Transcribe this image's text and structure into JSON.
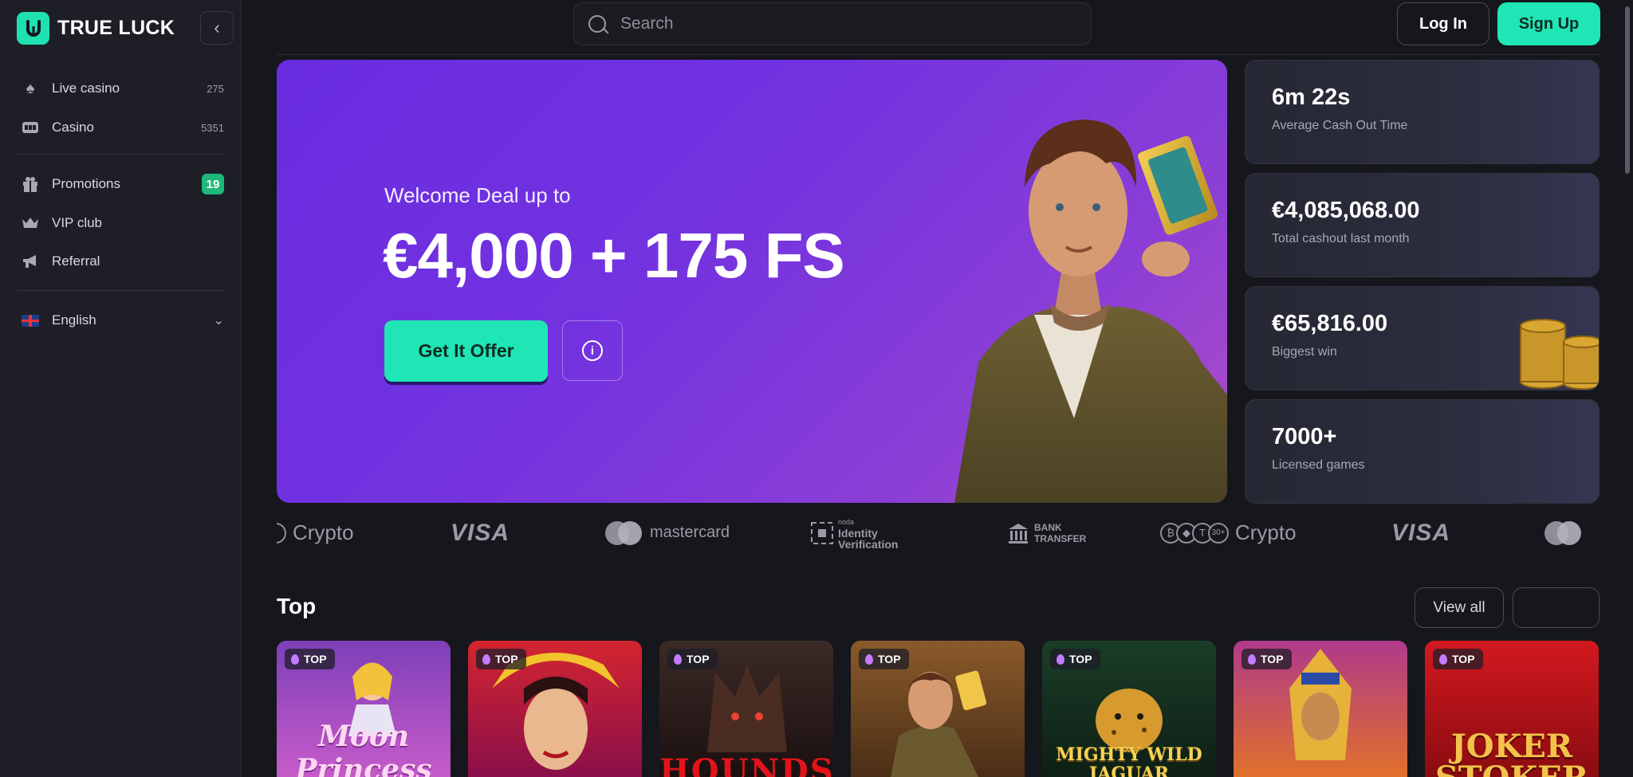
{
  "brand": {
    "name": "TRUE LUCK",
    "accent": "#1fe6b4"
  },
  "sidebar": {
    "items": [
      {
        "label": "Live casino",
        "count": "275",
        "icon": "spade-icon"
      },
      {
        "label": "Casino",
        "count": "5351",
        "icon": "slot-machine-icon"
      },
      {
        "label": "Promotions",
        "badge": "19",
        "icon": "gift-icon"
      },
      {
        "label": "VIP club",
        "icon": "crown-icon"
      },
      {
        "label": "Referral",
        "icon": "megaphone-icon"
      }
    ],
    "language": "English"
  },
  "header": {
    "search_placeholder": "Search",
    "login": "Log In",
    "signup": "Sign Up"
  },
  "hero": {
    "subtitle": "Welcome Deal up to",
    "headline": "€4,000 + 175 FS",
    "cta": "Get It Offer",
    "info_icon": "info-icon"
  },
  "stats": [
    {
      "value": "6m 22s",
      "label": "Average Cash Out Time"
    },
    {
      "value": "€4,085,068.00",
      "label": "Total cashout last month"
    },
    {
      "value": "€65,816.00",
      "label": "Biggest win"
    },
    {
      "value": "7000+",
      "label": "Licensed games"
    }
  ],
  "payments": {
    "crypto": "Crypto",
    "visa": "VISA",
    "mastercard": "mastercard",
    "noda_small": "noda",
    "noda_line1": "Identity",
    "noda_line2": "Verification",
    "bank_line1": "BANK",
    "bank_line2": "TRANSFER",
    "crypto_more": "30+"
  },
  "top_section": {
    "title": "Top",
    "view_all": "View all",
    "tag": "TOP",
    "games": [
      {
        "title": "Moon Princess",
        "bg": "#a04fc0"
      },
      {
        "title": "",
        "bg": "#c21f2a"
      },
      {
        "title": "HOUNDS",
        "bg": "#2a1a18"
      },
      {
        "title": "",
        "bg": "#7a4e24"
      },
      {
        "title": "MIGHTY WILD JAGUAR",
        "bg": "#143222"
      },
      {
        "title": "",
        "bg": "#5a2a80"
      },
      {
        "title": "JOKER STOKER",
        "bg": "#c2141c"
      }
    ]
  }
}
